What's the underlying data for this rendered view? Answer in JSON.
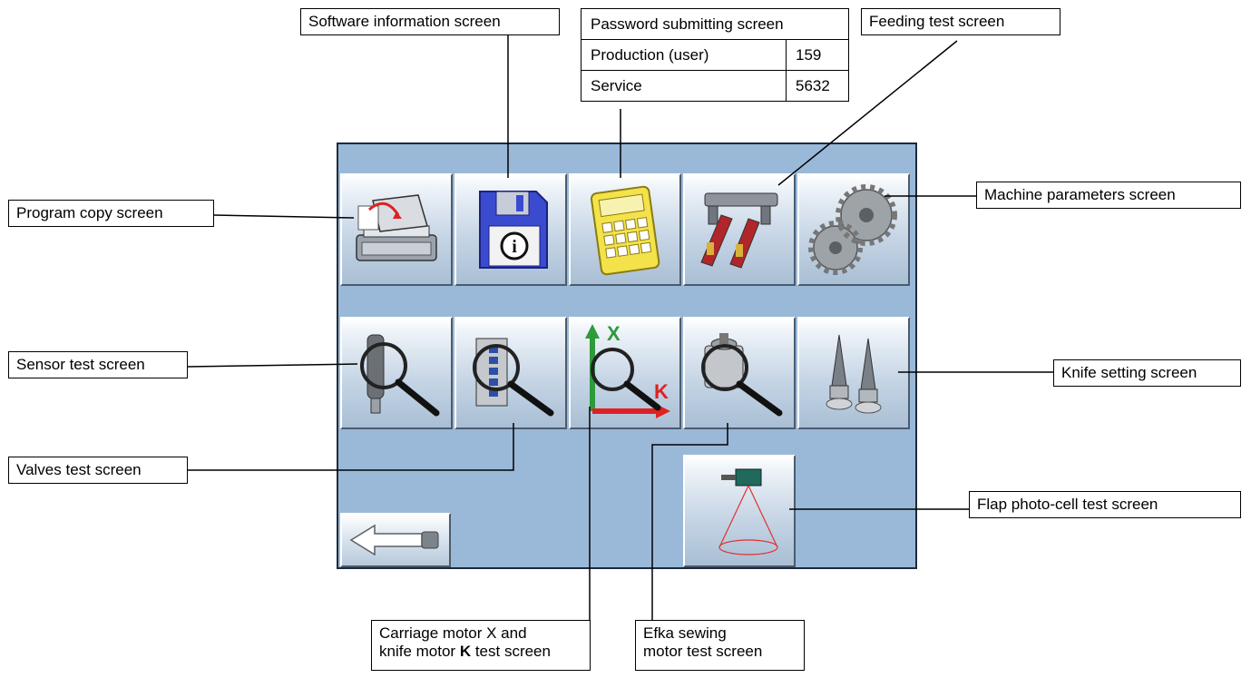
{
  "callouts": {
    "software_info": "Software information screen",
    "feeding_test": "Feeding test screen",
    "program_copy": "Program copy screen",
    "machine_params": "Machine parameters screen",
    "sensor_test": "Sensor test screen",
    "knife_setting": "Knife setting screen",
    "valves_test": "Valves test screen",
    "flap_photocell": "Flap photo-cell test screen",
    "carriage_line1": "Carriage motor X and",
    "carriage_line2a": "knife motor ",
    "carriage_line2b": "K",
    "carriage_line2c": " test screen",
    "efka_line1": "Efka sewing",
    "efka_line2": "motor test screen"
  },
  "password_table": {
    "title": "Password submitting screen",
    "rows": [
      {
        "label": "Production (user)",
        "code": "159"
      },
      {
        "label": "Service",
        "code": "5632"
      }
    ]
  },
  "axis_icon": {
    "x_label": "X",
    "k_label": "K"
  },
  "colors": {
    "screen_bg": "#9ab9d9",
    "axis_x": "#2e9a3c",
    "axis_k": "#e02020",
    "disk": "#3a4bd0",
    "calculator": "#f4e24a"
  },
  "icons": [
    "program-copy-icon",
    "floppy-info-icon",
    "calculator-icon",
    "feeder-icon",
    "gears-icon",
    "sensor-magnifier-icon",
    "valves-magnifier-icon",
    "axis-magnifier-icon",
    "motor-magnifier-icon",
    "knives-icon",
    "photocell-icon",
    "back-arrow-icon"
  ]
}
